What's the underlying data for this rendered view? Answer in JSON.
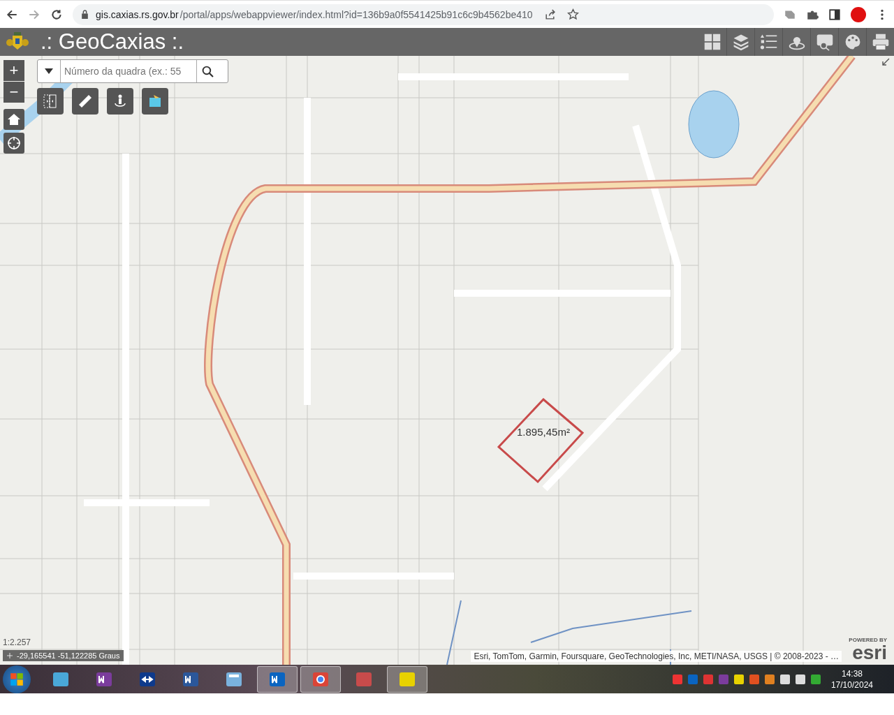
{
  "browser": {
    "url_host": "gis.caxias.rs.gov.br",
    "url_path": "/portal/apps/webappviewer/index.html?id=136b9a0f5541425b91c6c9b4562be410"
  },
  "app": {
    "title": ".: GeoCaxias :.",
    "tools": [
      {
        "kind": "grid"
      },
      {
        "kind": "layers"
      },
      {
        "kind": "legend"
      },
      {
        "kind": "pin"
      },
      {
        "kind": "query"
      },
      {
        "kind": "palette"
      },
      {
        "kind": "print"
      }
    ]
  },
  "map": {
    "zoom_in": "+",
    "zoom_out": "−",
    "search": {
      "placeholder": "Número da quadra (ex.: 55"
    },
    "tools": [
      {
        "kind": "swipe"
      },
      {
        "kind": "ruler"
      },
      {
        "kind": "person"
      },
      {
        "kind": "folder"
      }
    ],
    "measurement": "1.895,45m²",
    "scale": "1:2.257",
    "coordinates": "-29,165541 -51,122285 Graus",
    "attribution": "Esri, TomTom, Garmin, Foursquare, GeoTechnologies, Inc, METI/NASA, USGS | © 2008-2023 - …",
    "logo_caption": "POWERED BY",
    "logo": "esri"
  },
  "taskbar": {
    "apps": [
      {
        "kind": "scanner",
        "active": false
      },
      {
        "kind": "onenote",
        "active": false
      },
      {
        "kind": "teamviewer",
        "active": false
      },
      {
        "kind": "word",
        "active": false
      },
      {
        "kind": "calculator",
        "active": false
      },
      {
        "kind": "outlook",
        "active": true
      },
      {
        "kind": "chrome",
        "active": true
      },
      {
        "kind": "snip",
        "active": false
      },
      {
        "kind": "info",
        "active": true
      }
    ],
    "time": "14:38",
    "date": "17/10/2024"
  }
}
